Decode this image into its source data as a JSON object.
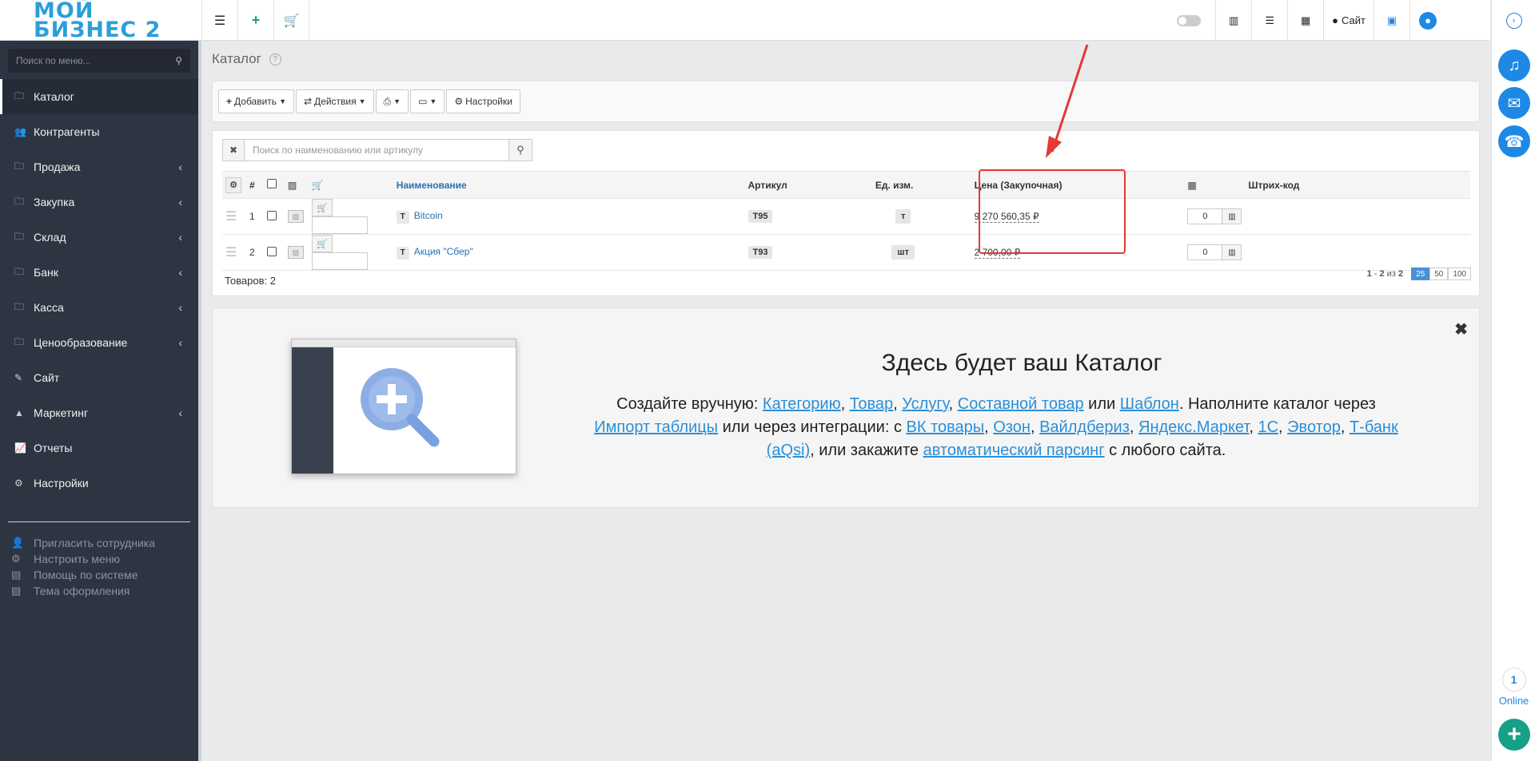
{
  "logo": {
    "line1": "МОЙ",
    "line2": "БИЗНЕС 2"
  },
  "topbar": {
    "left_icons": [
      "menu-icon",
      "plus-icon",
      "cart-icon"
    ],
    "site_label": "Сайт"
  },
  "sidebar": {
    "search_placeholder": "Поиск по меню...",
    "items": [
      {
        "label": "Каталог",
        "icon": "folder-icon",
        "active": true,
        "has_children": false
      },
      {
        "label": "Контрагенты",
        "icon": "users-icon",
        "has_children": false
      },
      {
        "label": "Продажа",
        "icon": "folder-icon",
        "has_children": true
      },
      {
        "label": "Закупка",
        "icon": "folder-icon",
        "has_children": true
      },
      {
        "label": "Склад",
        "icon": "folder-icon",
        "has_children": true
      },
      {
        "label": "Банк",
        "icon": "folder-icon",
        "has_children": true
      },
      {
        "label": "Касса",
        "icon": "folder-icon",
        "has_children": true
      },
      {
        "label": "Ценообразование",
        "icon": "folder-icon",
        "has_children": true
      },
      {
        "label": "Сайт",
        "icon": "wand-icon",
        "has_children": false
      },
      {
        "label": "Маркетинг",
        "icon": "chart-area-icon",
        "has_children": true
      },
      {
        "label": "Отчеты",
        "icon": "line-chart-icon",
        "has_children": false
      },
      {
        "label": "Настройки",
        "icon": "gear-icon",
        "has_children": false
      }
    ],
    "bottom_links": [
      {
        "label": "Пригласить сотрудника",
        "icon": "user-plus-icon"
      },
      {
        "label": "Настроить меню",
        "icon": "cogs-icon"
      },
      {
        "label": "Помощь по системе",
        "icon": "book-icon"
      },
      {
        "label": "Тема оформления",
        "icon": "image-icon"
      }
    ]
  },
  "page": {
    "title": "Каталог"
  },
  "toolbar": {
    "add_label": "Добавить",
    "actions_label": "Действия",
    "settings_label": "Настройки"
  },
  "table": {
    "search_placeholder": "Поиск по наименованию или артикулу",
    "headers": {
      "num": "#",
      "name": "Наименование",
      "article": "Артикул",
      "unit": "Ед. изм.",
      "price": "Цена (Закупочная)",
      "barcode": "Штрих-код"
    },
    "rows": [
      {
        "num": "1",
        "type": "Т",
        "name": "Bitcoin",
        "article": "Т95",
        "unit": "т",
        "price": "9 270 560,35 ₽",
        "stock": "0"
      },
      {
        "num": "2",
        "type": "Т",
        "name": "Акция \"Сбер\"",
        "article": "Т93",
        "unit": "шт",
        "price": "2 700,00 ₽",
        "stock": "0"
      }
    ],
    "footer_count": "Товаров: 2",
    "pager": {
      "range_from": "1",
      "range_to": "2",
      "of": "из",
      "total": "2",
      "sizes": [
        "25",
        "50",
        "100"
      ],
      "active_size": "25"
    }
  },
  "promo": {
    "title": "Здесь будет ваш Каталог",
    "t1": "Создайте вручную: ",
    "l_category": "Категорию",
    "l_product": "Товар",
    "l_service": "Услугу",
    "l_composite": "Составной товар",
    "t_or": " или ",
    "l_template": "Шаблон",
    "t2": ". Наполните каталог через ",
    "l_import": "Импорт таблицы",
    "t3": " или через интеграции: с ",
    "l_vk": "ВК товары",
    "l_ozon": "Озон",
    "l_wb": "Вайлдбериз",
    "l_ym": "Яндекс.Маркет",
    "l_1c": "1С",
    "l_evotor": "Эвотор",
    "l_tbank": "Т-банк (aQsi)",
    "t4": ", или закажите ",
    "l_parse": "автоматический парсинг",
    "t5": " с любого сайта."
  },
  "rail": {
    "online_count": "1",
    "online_label": "Online"
  },
  "colors": {
    "sidebar": "#2e3542",
    "accent": "#1e88e5",
    "link": "#2a6fb3",
    "highlight": "#e53935",
    "green": "#16a085"
  }
}
